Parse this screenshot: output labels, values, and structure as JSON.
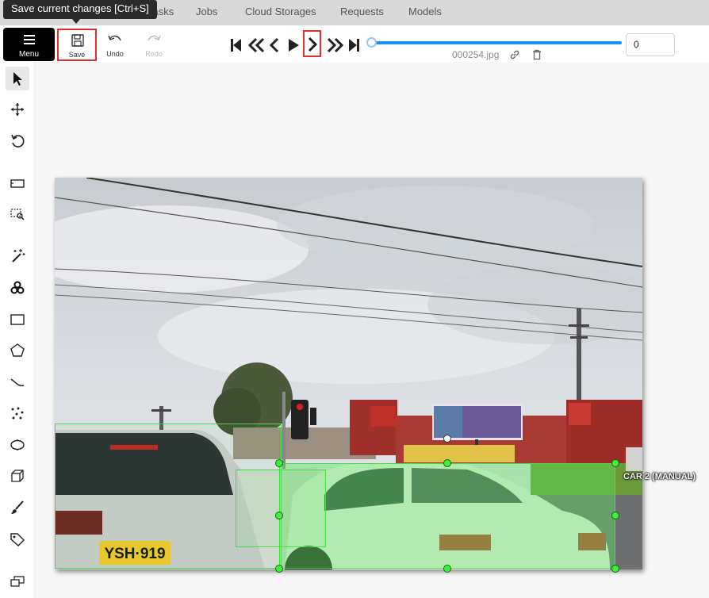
{
  "tooltip": {
    "text": "Save current changes [Ctrl+S]"
  },
  "nav": {
    "items": [
      "Tasks",
      "Jobs",
      "Cloud Storages",
      "Requests",
      "Models"
    ]
  },
  "toolbar": {
    "menu_label": "Menu",
    "save_label": "Save",
    "undo_label": "Undo",
    "redo_label": "Redo"
  },
  "player": {
    "filename": "000254.jpg",
    "frame_value": "0",
    "progress_fraction": 0.0
  },
  "annotation": {
    "label": "CAR 2 (MANUAL)",
    "box_color": "#44dd44"
  },
  "colors": {
    "accent": "#1890ff",
    "highlight": "#e03030",
    "shape": "#3ef03e"
  },
  "icons": [
    "save-icon",
    "undo-icon",
    "redo-icon",
    "first-frame-icon",
    "fast-backward-icon",
    "previous-icon",
    "play-icon",
    "next-icon",
    "fast-forward-icon",
    "last-frame-icon",
    "link-icon",
    "trash-icon",
    "cursor-icon",
    "move-icon",
    "rotate-icon",
    "fit-icon",
    "zoom-region-icon",
    "magic-wand-icon",
    "openvino-icon",
    "rectangle-icon",
    "polygon-icon",
    "polyline-icon",
    "points-icon",
    "ellipse-icon",
    "cuboid-icon",
    "brush-icon",
    "tag-icon",
    "group-icon"
  ]
}
